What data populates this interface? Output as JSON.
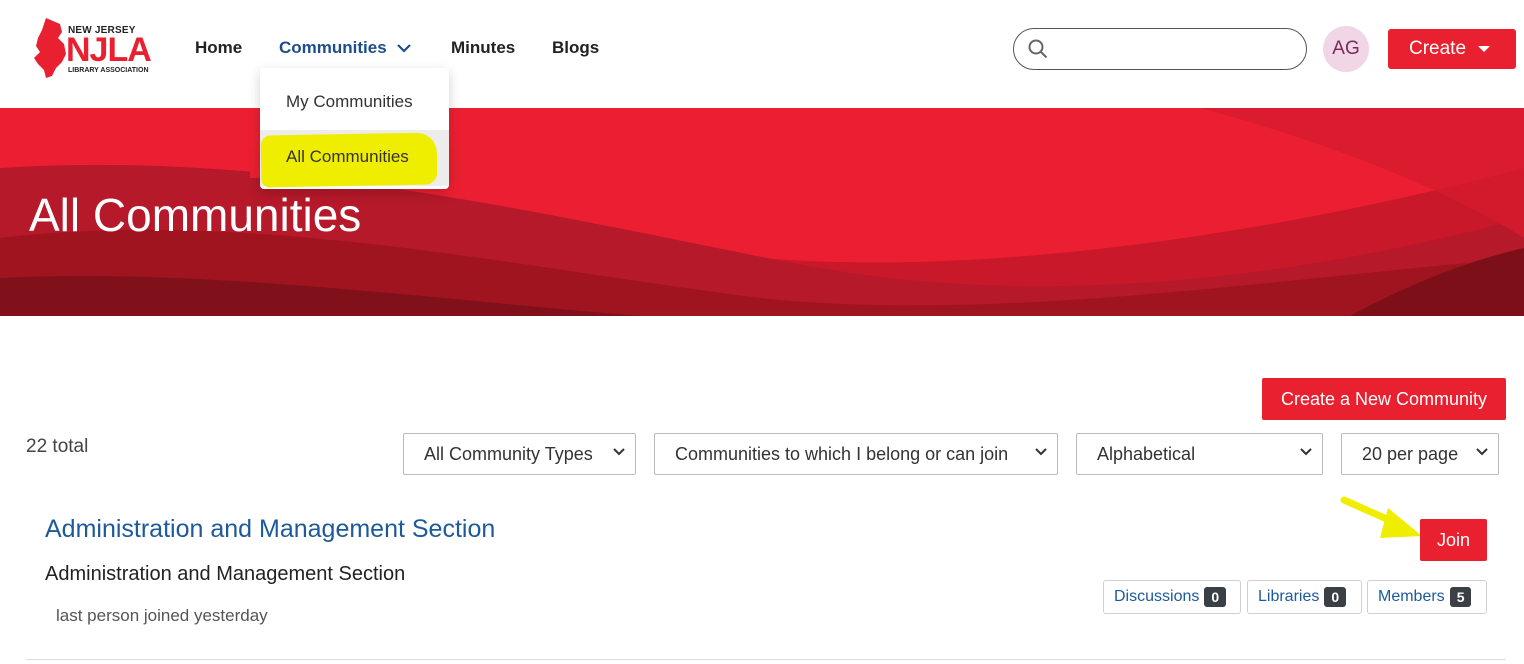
{
  "logo": {
    "top": "NEW JERSEY",
    "main": "NJLA",
    "bottom": "LIBRARY ASSOCIATION"
  },
  "nav": {
    "home": "Home",
    "communities": "Communities",
    "minutes": "Minutes",
    "blogs": "Blogs"
  },
  "search": {
    "placeholder": "",
    "value": ""
  },
  "user": {
    "initials": "AG"
  },
  "create_label": "Create",
  "dropdown": {
    "items": [
      {
        "label": "My Communities"
      },
      {
        "label": "All Communities"
      }
    ]
  },
  "hero": {
    "title": "All Communities"
  },
  "toolbar": {
    "create_community": "Create a New Community",
    "total": "22 total",
    "filters": {
      "type": "All Community Types",
      "membership": "Communities to which I belong or can join",
      "sort": "Alphabetical",
      "per_page": "20 per page"
    }
  },
  "community": {
    "title": "Administration and Management Section",
    "description": "Administration and Management Section",
    "meta": "last person joined yesterday",
    "join_label": "Join",
    "stats": [
      {
        "label": "Discussions",
        "count": "0"
      },
      {
        "label": "Libraries",
        "count": "0"
      },
      {
        "label": "Members",
        "count": "5"
      }
    ]
  },
  "colors": {
    "brand_red": "#e8202f",
    "link_blue": "#1d5a9a",
    "highlight_yellow": "#f0ee00"
  }
}
